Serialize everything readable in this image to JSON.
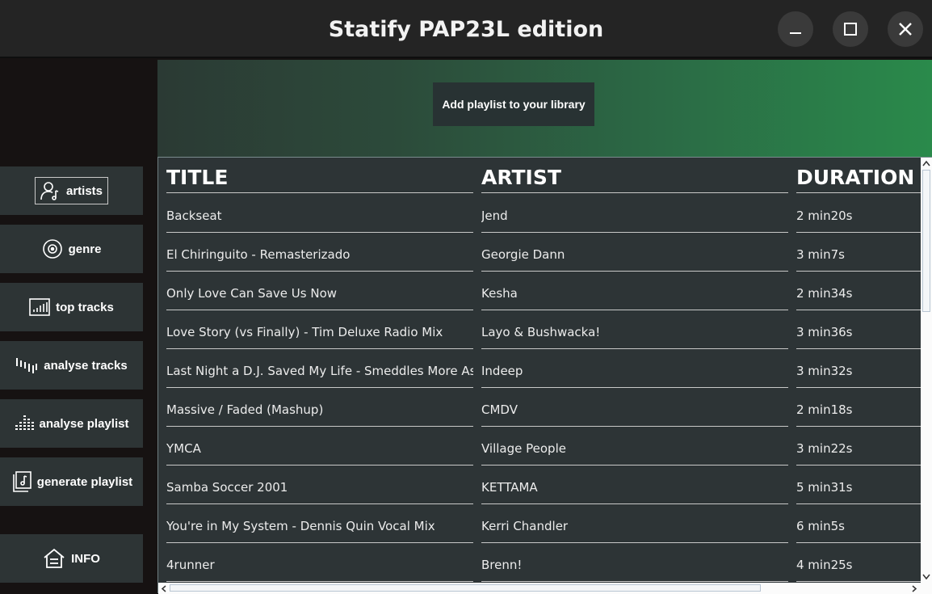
{
  "window": {
    "title": "Statify PAP23L edition"
  },
  "sidebar": {
    "items": [
      {
        "label": "artists",
        "icon": "user-music-icon",
        "selected": true
      },
      {
        "label": "genre",
        "icon": "vinyl-disc-icon"
      },
      {
        "label": "top tracks",
        "icon": "bar-chart-icon"
      },
      {
        "label": "analyse tracks",
        "icon": "waveform-icon"
      },
      {
        "label": "analyse playlist",
        "icon": "equalizer-icon"
      },
      {
        "label": "generate playlist",
        "icon": "playlist-icon"
      }
    ],
    "info": {
      "label": "INFO",
      "icon": "home-info-icon"
    }
  },
  "banner": {
    "button_label": "Add playlist to your library"
  },
  "table": {
    "columns": [
      "TITLE",
      "ARTIST",
      "DURATION"
    ],
    "rows": [
      [
        "Backseat",
        "Jend",
        "2 min20s"
      ],
      [
        "El Chiringuito - Remasterizado",
        "Georgie Dann",
        "3 min7s"
      ],
      [
        "Only Love Can Save Us Now",
        "Kesha",
        "2 min34s"
      ],
      [
        "Love Story (vs Finally) - Tim Deluxe Radio Mix",
        "Layo & Bushwacka!",
        "3 min36s"
      ],
      [
        "Last Night a D.J. Saved My Life - Smeddles More Ass Edit",
        "Indeep",
        "3 min32s"
      ],
      [
        "Massive / Faded (Mashup)",
        "CMDV",
        "2 min18s"
      ],
      [
        "YMCA",
        "Village People",
        "3 min22s"
      ],
      [
        "Samba Soccer 2001",
        "KETTAMA",
        "5 min31s"
      ],
      [
        "You're in My System - Dennis Quin Vocal Mix",
        "Kerri Chandler",
        "6 min5s"
      ],
      [
        "4runner",
        "Brenn!",
        "4 min25s"
      ]
    ]
  },
  "colors": {
    "titlebar": "#242424",
    "sidebar_bg": "#161212",
    "button_bg": "#2d3435",
    "table_bg": "#2d3436",
    "banner_end": "#2a8a4b"
  }
}
